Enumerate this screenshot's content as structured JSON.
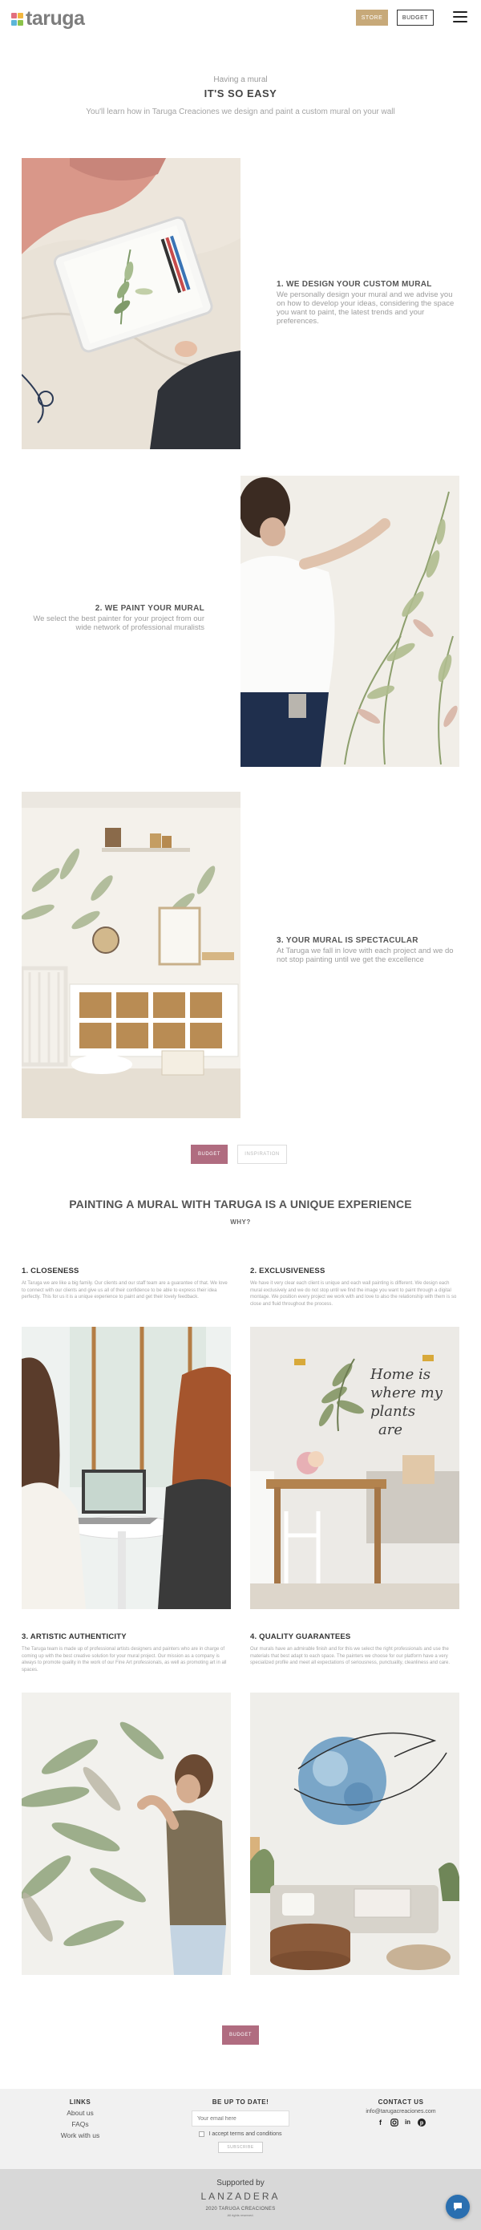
{
  "header": {
    "logo_text": "taruga",
    "store_label": "STORE",
    "budget_label": "BUDGET"
  },
  "intro": {
    "kicker": "Having a mural",
    "title": "IT'S SO EASY",
    "subtitle": "You'll learn how in Taruga Creaciones we design and paint a custom mural on your wall"
  },
  "steps": [
    {
      "title": "1. WE DESIGN YOUR CUSTOM MURAL",
      "description": "We personally design your mural and we advise you on how to develop your ideas, considering the space you want to paint, the latest trends and your preferences."
    },
    {
      "title": "2. WE PAINT YOUR MURAL",
      "description": "We select the best painter for your project from our wide network of professional muralists"
    },
    {
      "title": "3. YOUR MURAL IS SPECTACULAR",
      "description": "At Taruga we fall in love with each project and we do not stop painting until we get the excellence"
    }
  ],
  "cta": {
    "budget_label": "BUDGET",
    "inspiration_label": "INSPIRATION"
  },
  "unique": {
    "title": "PAINTING A MURAL WITH TARUGA IS A UNIQUE EXPERIENCE",
    "why": "WHY?"
  },
  "features": [
    {
      "title": "1. CLOSENESS",
      "description": "At Taruga we are like a big family. Our clients and our staff team are a guarantee of that. We love to connect with our clients and give us all of their confidence to be able to express their idea perfectly. This for us it is a unique experience to paint and get their lovely feedback."
    },
    {
      "title": "2. EXCLUSIVENESS",
      "description": "We have it very clear each client is unique and each wall painting is different. We design each mural exclusively and we do not stop until we find the image you want to paint through a digital montage. We position every project we work with and love to also the relationship with them is so close and fluid throughout the process."
    },
    {
      "title": "3. ARTISTIC AUTHENTICITY",
      "description": "The Taruga team is made up of professional artists designers and painters who are in charge of coming up with the best creative solution for your mural project. Our mission as a company is always to promote quality in the work of our Fine Art professionals, as well as promoting art in all spaces."
    },
    {
      "title": "4. QUALITY GUARANTEES",
      "description": "Our murals have an admirable finish and for this we select the right professionals and use the materials that best adapt to each space. The painters we choose for our platform have a very specialized profile and meet all expectations of seriousness, punctuality, cleanliness and care."
    }
  ],
  "bottom_cta": {
    "budget_label": "BUDGET"
  },
  "footer": {
    "links_heading": "LINKS",
    "links": [
      "About us",
      "FAQs",
      "Work with us"
    ],
    "newsletter_heading": "BE UP TO DATE!",
    "email_placeholder": "Your email here",
    "terms_label": "I accept terms and conditions",
    "subscribe_label": "SUBSCRIBE",
    "contact_heading": "CONTACT US",
    "contact_email": "info@tarugacreaciones.com",
    "social_icons": [
      "facebook-icon",
      "instagram-icon",
      "linkedin-icon",
      "pinterest-icon"
    ]
  },
  "bottom_bar": {
    "supported_by": "Supported by",
    "sponsor": "LANZADERA",
    "copyright": "2020 TARUGA CREACIONES",
    "rights": "All rights reserved."
  },
  "colors": {
    "accent_gold": "#c7a979",
    "accent_pink": "#b06c80",
    "chat_blue": "#2a6fb0"
  }
}
